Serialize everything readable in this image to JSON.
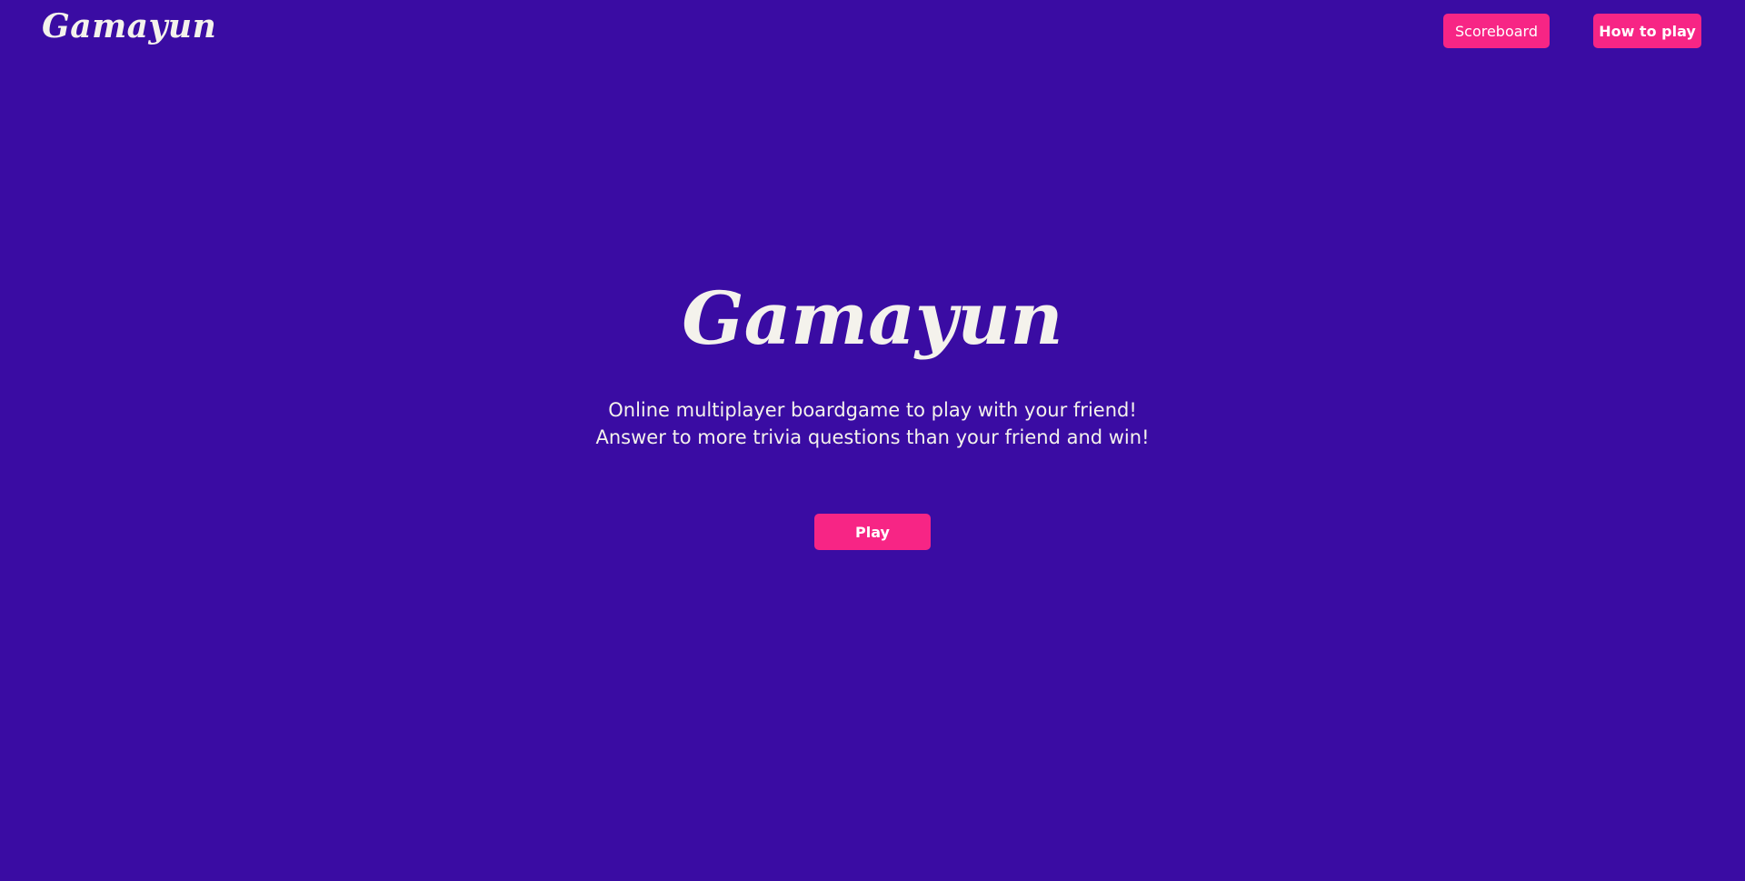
{
  "header": {
    "logo_text": "Gamayun",
    "nav": {
      "scoreboard_label": "Scoreboard",
      "how_to_play_label": "How to play"
    }
  },
  "hero": {
    "title": "Gamayun",
    "subtitle_line1": "Online multiplayer boardgame to play with your friend!",
    "subtitle_line2": "Answer to more trivia questions than your friend and win!",
    "play_label": "Play"
  },
  "colors": {
    "background": "#3a0ca3",
    "accent": "#f72585",
    "text": "#f4f2ec"
  }
}
